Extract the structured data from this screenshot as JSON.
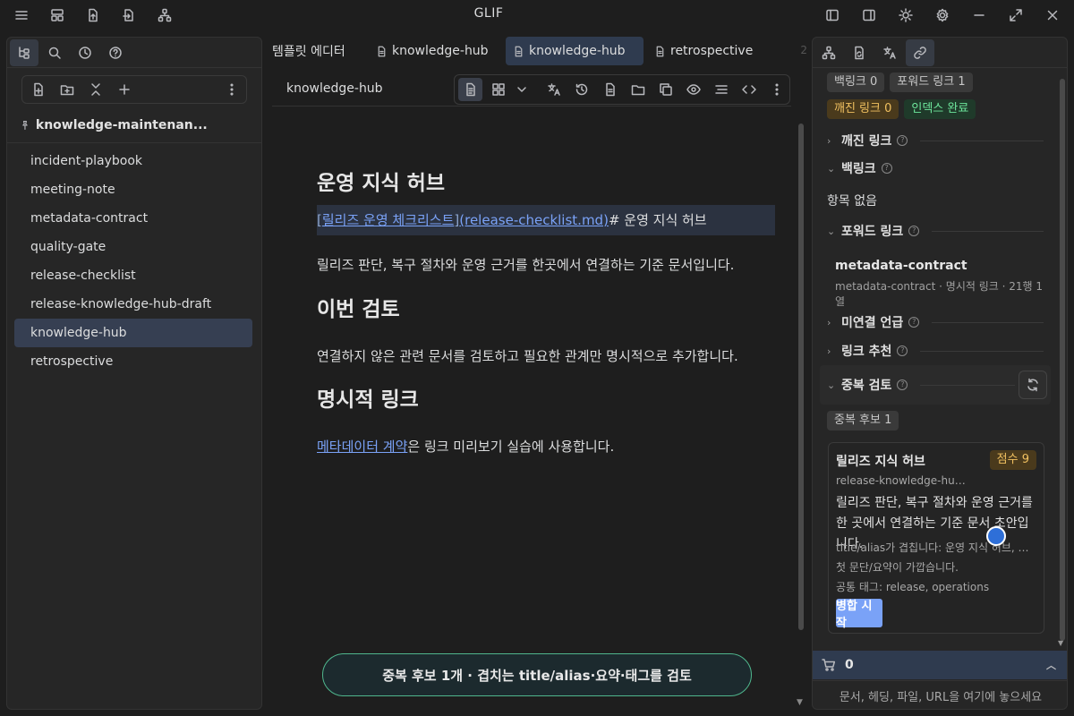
{
  "app": {
    "title": "GLIF"
  },
  "left_sidebar": {
    "vault_name": "knowledge-maintenan...",
    "files": [
      "incident-playbook",
      "meeting-note",
      "metadata-contract",
      "quality-gate",
      "release-checklist",
      "release-knowledge-hub-draft",
      "knowledge-hub",
      "retrospective"
    ],
    "active_file": "knowledge-hub"
  },
  "tabs": [
    {
      "label": "템플릿 에디터"
    },
    {
      "label": "knowledge-hub"
    },
    {
      "label": "knowledge-hub"
    },
    {
      "label": "retrospective"
    }
  ],
  "tab_overflow": "2",
  "editor": {
    "view_title": "knowledge-hub",
    "h1": "운영 지식 허브",
    "src_open": "[",
    "src_link_text": "릴리즈 운영 체크리스트",
    "src_mid": "]",
    "src_link_target": "(release-checklist.md)",
    "src_tail": "# 운영 지식 허브",
    "p1": "릴리즈 판단, 복구 절차와 운영 근거를 한곳에서 연결하는 기준 문서입니다.",
    "h2": "이번 검토",
    "p2": "연결하지 않은 관련 문서를 검토하고 필요한 관계만 명시적으로 추가합니다.",
    "h3": "명시적 링크",
    "p3_link": "메타데이터 계약",
    "p3_tail": "은 링크 미리보기 실습에 사용합니다.",
    "toast": "중복 후보 1개 · 겹치는 title/alias·요약·태그를 검토"
  },
  "right_sidebar": {
    "badges": {
      "backlinks": "백링크 0",
      "forward": "포워드 링크 1",
      "broken": "깨진 링크 0",
      "index": "인덱스 완료"
    },
    "sections": {
      "broken": "깨진 링크",
      "backlinks": "백링크",
      "empty": "항목 없음",
      "forward": "포워드 링크",
      "unlinked": "미연결 언급",
      "suggest": "링크 추천",
      "duplicate": "중복 검토"
    },
    "forward_item": {
      "title": "metadata-contract",
      "meta": "metadata-contract · 명시적 링크 · 21행 1열"
    },
    "dup_badge": "중복 후보 1",
    "card": {
      "title": "릴리즈 지식 허브",
      "score": "점수 9",
      "path": "release-knowledge-hub-...",
      "summary": "릴리즈 판단, 복구 절차와 운영 근거를 한 곳에서 연결하는 기준 문서 초안입니다.",
      "reason1": "title/alias가 겹칩니다: 운영 지식 허브, 릴리...",
      "reason2": "첫 문단/요약이 가깝습니다.",
      "reason3": "공통 태그: release, operations",
      "merge": "병합 시작"
    },
    "cart_count": "0",
    "drop_hint": "문서, 헤딩, 파일, URL을 여기에 놓으세요"
  }
}
